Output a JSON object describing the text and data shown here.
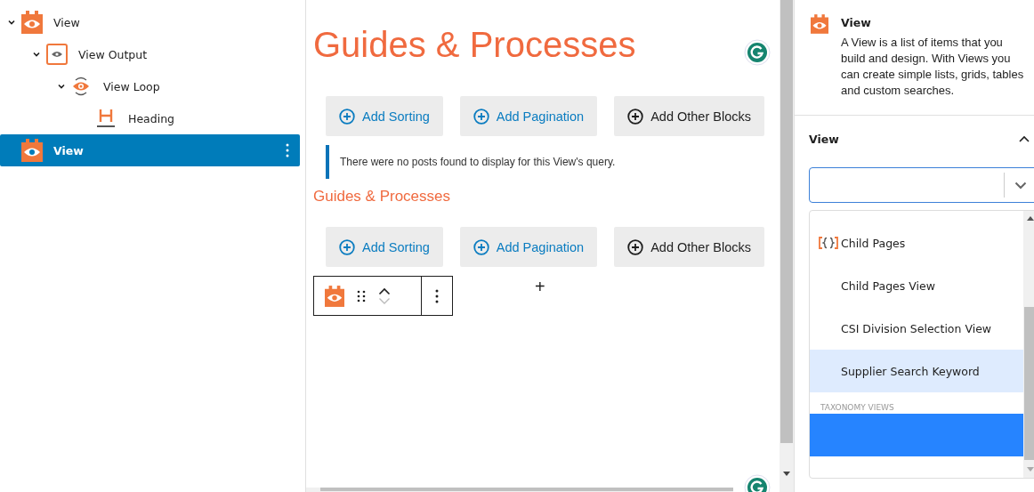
{
  "tree": [
    {
      "label": "View",
      "kind": "view",
      "selected": false,
      "expanded": true,
      "children": [
        {
          "label": "View Output",
          "kind": "output",
          "selected": false,
          "expanded": true,
          "children": [
            {
              "label": "View Loop",
              "kind": "loop",
              "selected": false,
              "expanded": true,
              "children": [
                {
                  "label": "Heading",
                  "kind": "heading",
                  "selected": false
                }
              ]
            }
          ]
        }
      ]
    },
    {
      "label": "View",
      "kind": "view",
      "selected": true
    }
  ],
  "editor": {
    "title": "Guides & Processes",
    "button_rows": [
      [
        {
          "label": "Add Sorting",
          "kind": "blue"
        },
        {
          "label": "Add Pagination",
          "kind": "blue"
        },
        {
          "label": "Add Other Blocks",
          "kind": "dark"
        }
      ],
      [
        {
          "label": "Add Sorting",
          "kind": "blue"
        },
        {
          "label": "Add Pagination",
          "kind": "blue"
        },
        {
          "label": "Add Other Blocks",
          "kind": "dark"
        }
      ]
    ],
    "notice": "There were no posts found to display for this View's query.",
    "subtitle": "Guides & Processes",
    "add_block": "+"
  },
  "inspector": {
    "block_title": "View",
    "block_description": "A View is a list of items that you build and design. With Views you can create simple lists, grids, tables and custom searches.",
    "section_title": "View",
    "section_expanded": true,
    "options": [
      {
        "kind": "option",
        "label": "Child Pages",
        "has_icon": true,
        "highlighted": false,
        "selected": false
      },
      {
        "kind": "option",
        "label": "Child Pages View",
        "has_icon": false,
        "highlighted": false,
        "selected": false
      },
      {
        "kind": "option",
        "label": "CSI Division Selection View",
        "has_icon": false,
        "highlighted": false,
        "selected": false
      },
      {
        "kind": "option",
        "label": "Supplier Search Keyword",
        "has_icon": false,
        "highlighted": true,
        "selected": false
      },
      {
        "kind": "group",
        "label": "TAXONOMY VIEWS"
      },
      {
        "kind": "option",
        "has_icon": false,
        "highlighted": false,
        "selected": true
      }
    ]
  }
}
